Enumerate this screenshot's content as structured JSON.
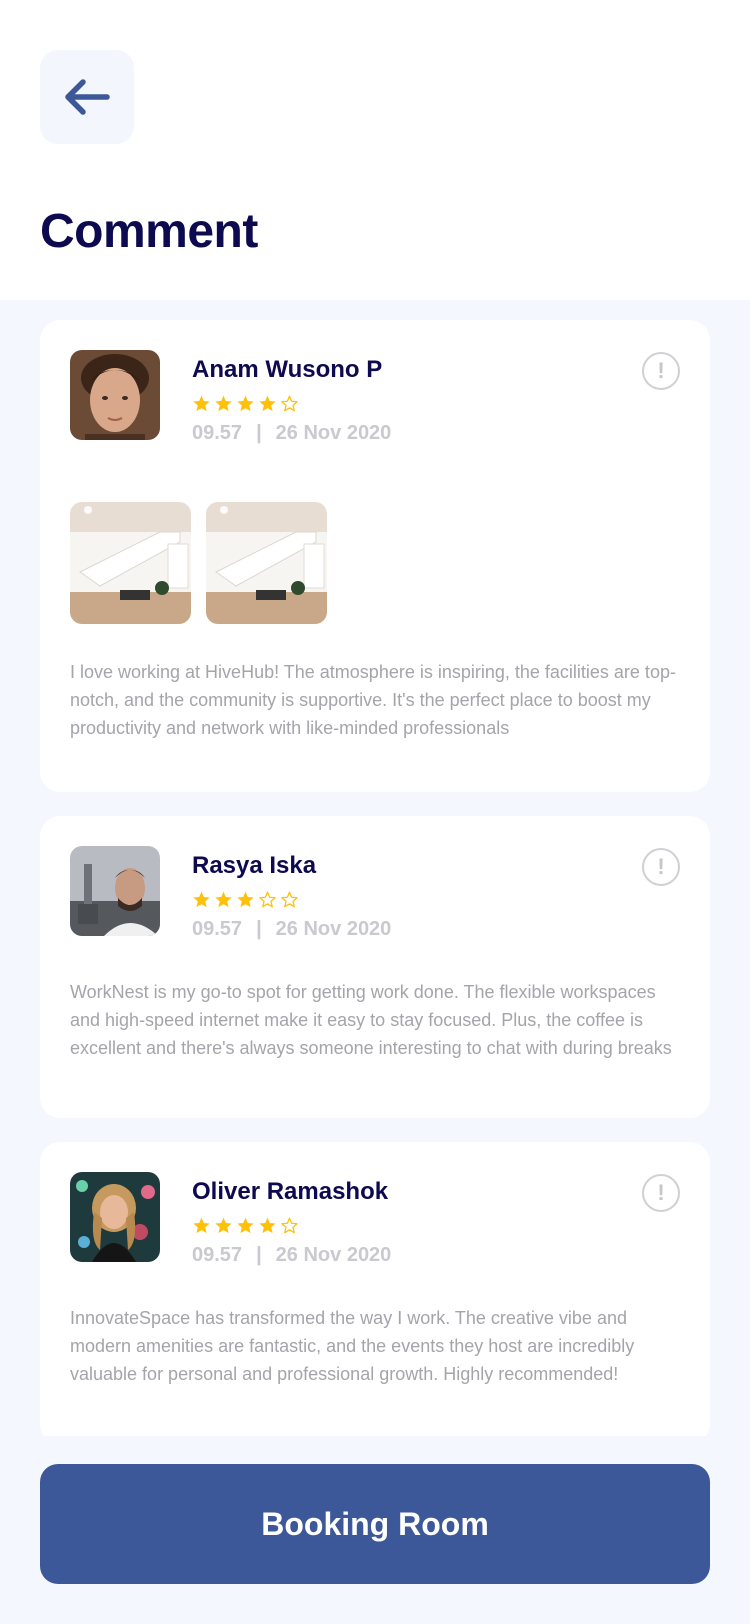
{
  "header": {
    "title": "Comment",
    "back_icon": "arrow-left-icon"
  },
  "reviews": [
    {
      "name": "Anam Wusono P",
      "rating": 4,
      "rating_max": 5,
      "time": "09.57",
      "separator": "|",
      "date": "26 Nov 2020",
      "photos_count": 2,
      "text": "I love working at HiveHub! The atmosphere is inspiring, the facilities are top-notch, and the community is supportive. It's the perfect place to boost my productivity and network with like-minded professionals"
    },
    {
      "name": "Rasya Iska",
      "rating": 3,
      "rating_max": 5,
      "time": "09.57",
      "separator": "|",
      "date": "26 Nov 2020",
      "text": "WorkNest is my go-to spot for getting work done. The flexible workspaces and high-speed internet make it easy to stay focused. Plus, the coffee is excellent and there's always someone interesting to chat with during breaks"
    },
    {
      "name": "Oliver Ramashok",
      "rating": 4,
      "rating_max": 5,
      "time": "09.57",
      "separator": "|",
      "date": "26 Nov 2020",
      "text": "InnovateSpace has transformed the way I work. The creative vibe and modern amenities are fantastic, and the events they host are incredibly valuable for personal and professional growth. Highly recommended!"
    }
  ],
  "report_icon": "exclamation-circle-icon",
  "report_glyph": "!",
  "footer": {
    "button_label": "Booking Room"
  },
  "colors": {
    "title": "#0d0a4f",
    "accent": "#3c5898",
    "star": "#ffc107",
    "muted": "#a4a4aa",
    "background": "#f4f7fd"
  }
}
